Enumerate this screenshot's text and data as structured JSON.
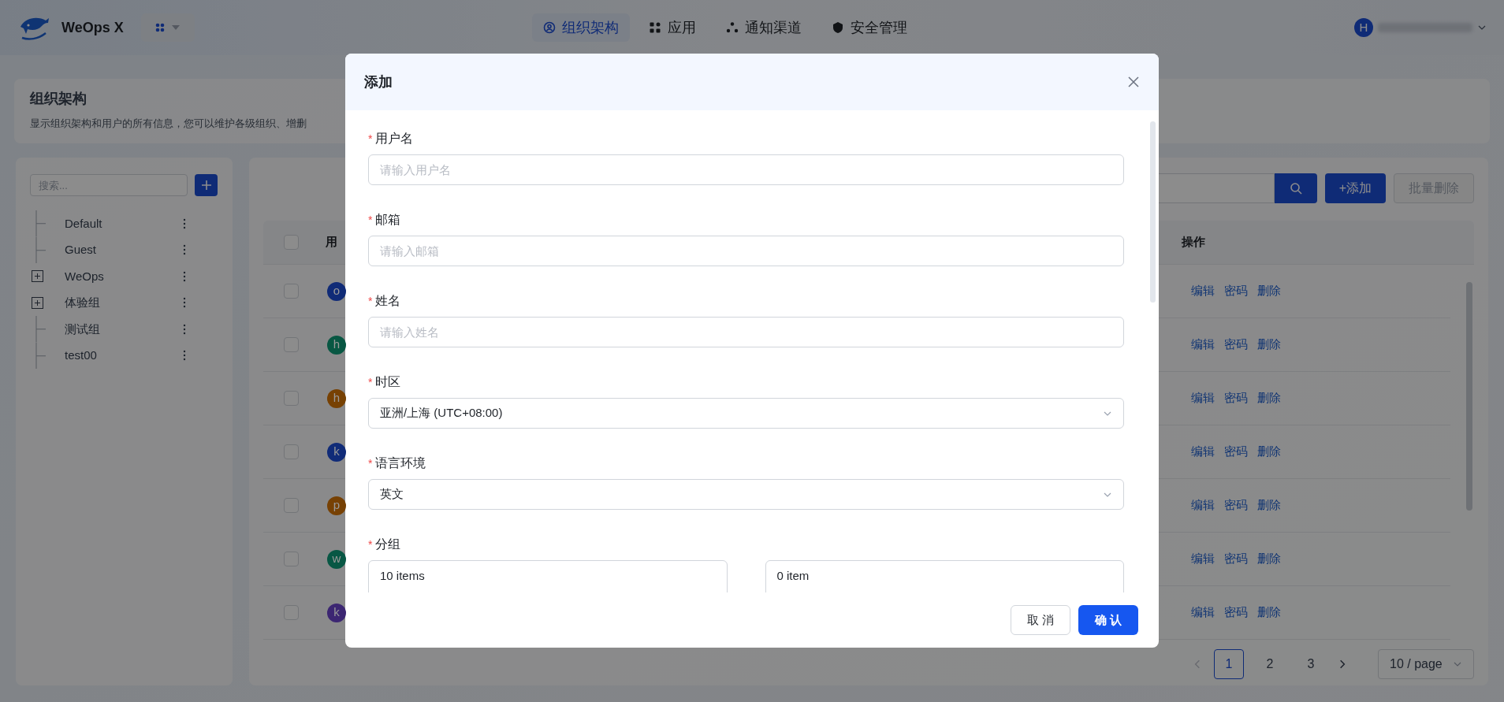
{
  "topbar": {
    "product": "WeOps X",
    "nav": [
      {
        "label": "组织架构",
        "selected": true
      },
      {
        "label": "应用",
        "selected": false
      },
      {
        "label": "通知渠道",
        "selected": false
      },
      {
        "label": "安全管理",
        "selected": false
      }
    ],
    "user_initial": "H"
  },
  "header": {
    "title": "组织架构",
    "description": "显示组织架构和用户的所有信息，您可以维护各级组织、增删"
  },
  "tree": {
    "search_placeholder": "搜索...",
    "items": [
      {
        "label": "Default",
        "kind": "leaf"
      },
      {
        "label": "Guest",
        "kind": "leaf"
      },
      {
        "label": "WeOps",
        "kind": "group",
        "expanded": false
      },
      {
        "label": "体验组",
        "kind": "group",
        "expanded": false
      },
      {
        "label": "测试组",
        "kind": "leaf"
      },
      {
        "label": "test00",
        "kind": "leaf"
      }
    ]
  },
  "toolbar": {
    "add": "+添加",
    "batch_delete": "批量删除"
  },
  "table": {
    "header_checked": false,
    "columns": [
      "用",
      "操作"
    ],
    "rows": [
      {
        "initial": "o",
        "color": "#102b77",
        "checked": false,
        "actions": [
          "编辑",
          "密码",
          "删除"
        ]
      },
      {
        "initial": "h",
        "color": "#085743",
        "checked": false,
        "actions": [
          "编辑",
          "密码",
          "删除"
        ]
      },
      {
        "initial": "h",
        "color": "#774103",
        "checked": false,
        "actions": [
          "编辑",
          "密码",
          "删除"
        ]
      },
      {
        "initial": "k",
        "color": "#102b78",
        "checked": false,
        "actions": [
          "编辑",
          "密码",
          "删除"
        ]
      },
      {
        "initial": "p",
        "color": "#774104",
        "checked": false,
        "actions": [
          "编辑",
          "密码",
          "删除"
        ]
      },
      {
        "initial": "w",
        "color": "#085744",
        "checked": false,
        "actions": [
          "编辑",
          "密码",
          "删除"
        ]
      },
      {
        "initial": "k",
        "color": "#3c2672",
        "checked": false,
        "actions": [
          "编辑",
          "密码",
          "删除"
        ]
      }
    ]
  },
  "pagination": {
    "pages": [
      {
        "label": "1",
        "selected": true
      },
      {
        "label": "2",
        "selected": false
      },
      {
        "label": "3",
        "selected": false
      }
    ],
    "page_size": "10 / page"
  },
  "dialog": {
    "title": "添加",
    "fields": [
      {
        "kind": "input",
        "label": "用户名",
        "required_mark": "*",
        "placeholder": "请输入用户名"
      },
      {
        "kind": "input",
        "label": "邮箱",
        "required_mark": "*",
        "placeholder": "请输入邮箱"
      },
      {
        "kind": "input",
        "label": "姓名",
        "required_mark": "*",
        "placeholder": "请输入姓名"
      },
      {
        "kind": "select",
        "label": "时区",
        "required_mark": "*",
        "value": "亚洲/上海 (UTC+08:00)"
      },
      {
        "kind": "select",
        "label": "语言环境",
        "required_mark": "*",
        "value": "英文"
      },
      {
        "kind": "transfer",
        "label": "分组",
        "required_mark": "*",
        "left": "10 items",
        "right": "0 item"
      }
    ],
    "cancel": "取 消",
    "confirm": "确 认"
  }
}
